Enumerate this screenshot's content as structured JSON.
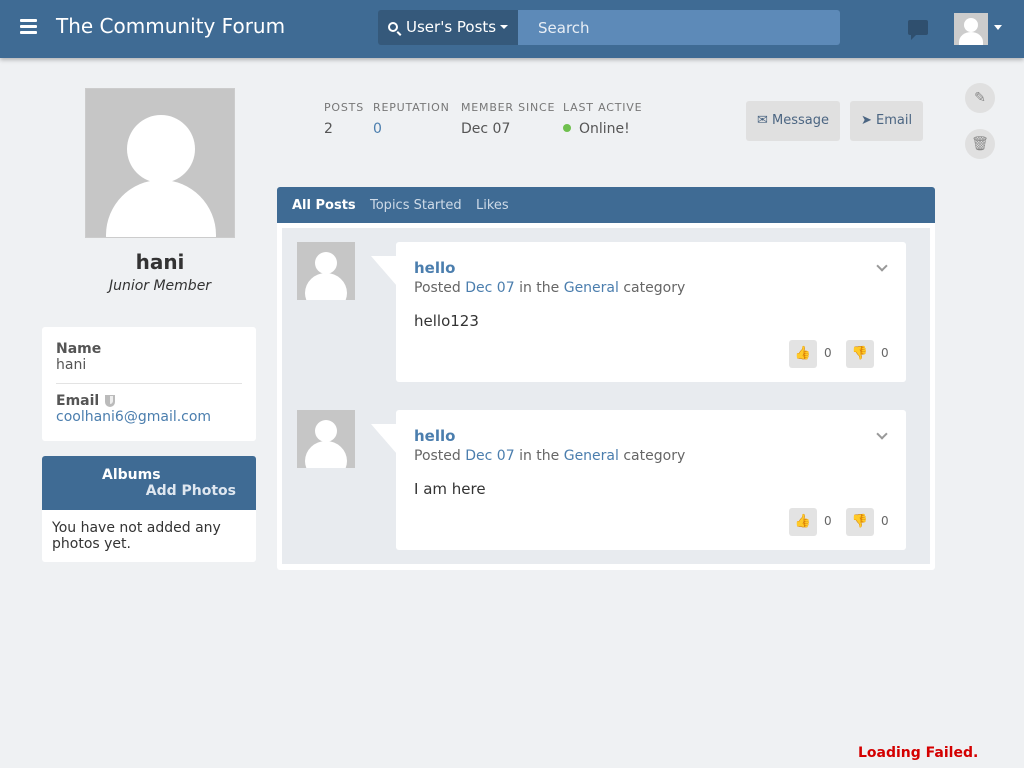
{
  "header": {
    "brand": "The Community Forum",
    "search_type": "User's Posts",
    "search_placeholder": "Search"
  },
  "profile": {
    "username": "hani",
    "title": "Junior Member",
    "name_label": "Name",
    "name_value": "hani",
    "email_label": "Email",
    "email_value": "coolhani6@gmail.com"
  },
  "albums": {
    "title": "Albums",
    "add_label": "Add Photos",
    "empty_text": "You have not added any photos yet."
  },
  "stats": {
    "posts_label": "POSTS",
    "posts_value": "2",
    "reputation_label": "REPUTATION",
    "reputation_value": "0",
    "member_since_label": "MEMBER SINCE",
    "member_since_value": "Dec 07",
    "last_active_label": "LAST ACTIVE",
    "last_active_value": "Online!"
  },
  "actions": {
    "message_label": "Message",
    "email_label": "Email",
    "message_icon": "✉",
    "email_icon": "➤",
    "edit_icon": "✎",
    "trash_icon": "🗑"
  },
  "tabs": {
    "all_posts": "All Posts",
    "topics_started": "Topics Started",
    "likes": "Likes"
  },
  "posts": [
    {
      "title": "hello",
      "posted_prefix": "Posted",
      "date": "Dec 07",
      "in_the": "in the",
      "category": "General",
      "category_suffix": "category",
      "body": "hello123",
      "upvotes": "0",
      "downvotes": "0"
    },
    {
      "title": "hello",
      "posted_prefix": "Posted",
      "date": "Dec 07",
      "in_the": "in the",
      "category": "General",
      "category_suffix": "category",
      "body": "I am here",
      "upvotes": "0",
      "downvotes": "0"
    }
  ],
  "vote_icons": {
    "up": "👍",
    "down": "👎"
  },
  "footer": {
    "loading_failed": "Loading Failed."
  },
  "colors": {
    "header": "#3f6b94",
    "link": "#4b7eae",
    "online": "#6fc04e",
    "error": "#d40000"
  }
}
